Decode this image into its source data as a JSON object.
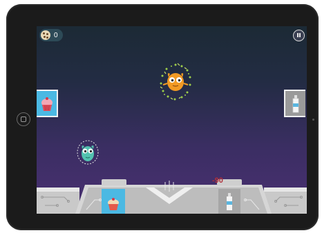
{
  "hud": {
    "score_value": "0",
    "score_icon": "cookie-icon",
    "pause_icon": "pause-icon"
  },
  "cards": {
    "left_item": "cupcake",
    "right_item": "milk-bottle"
  },
  "console": {
    "penalty_text": "-90",
    "tray_left_item": "cupcake",
    "tray_right_item": "milk-bottle"
  },
  "monsters": [
    {
      "name": "orange-monster",
      "state": "sparkling"
    },
    {
      "name": "teal-monster",
      "state": "dashed-ring"
    }
  ]
}
